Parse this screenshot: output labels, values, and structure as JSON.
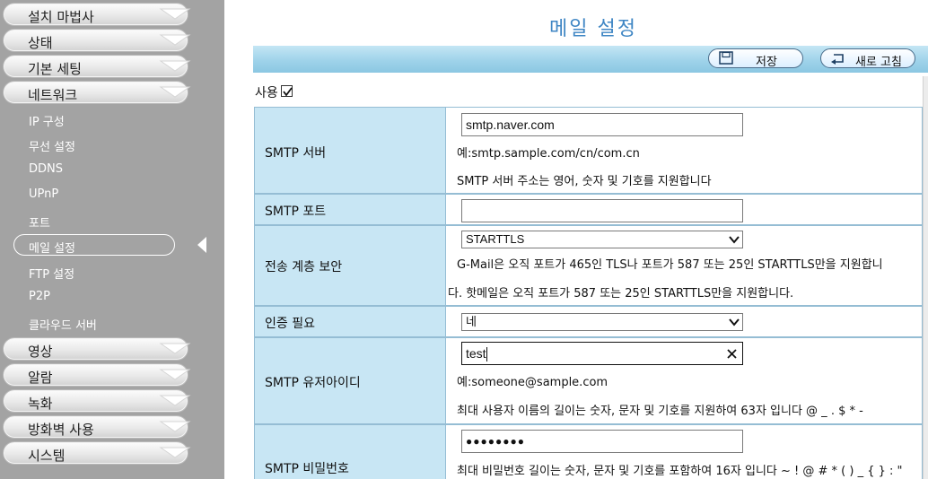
{
  "sidebar": {
    "menus_top": [
      {
        "label": "설치 마법사"
      },
      {
        "label": "상태"
      },
      {
        "label": "기본 세팅"
      },
      {
        "label": "네트워크"
      }
    ],
    "network_items": [
      {
        "label": "IP 구성"
      },
      {
        "label": "무선 설정"
      },
      {
        "label": "DDNS"
      },
      {
        "label": "UPnP"
      },
      {
        "label": "포트"
      },
      {
        "label": "메일 설정"
      },
      {
        "label": "FTP 설정"
      },
      {
        "label": "P2P"
      },
      {
        "label": "클라우드 서버"
      }
    ],
    "menus_bottom": [
      {
        "label": "영상"
      },
      {
        "label": "알람"
      },
      {
        "label": "녹화"
      },
      {
        "label": "방화벽 사용"
      },
      {
        "label": "시스템"
      }
    ]
  },
  "main": {
    "title": "메일 설정",
    "toolbar": {
      "save_label": "저장",
      "refresh_label": "새로 고침"
    },
    "enable": {
      "label": "사용",
      "checked": true
    },
    "form": {
      "smtp_server": {
        "label": "SMTP 서버",
        "value": "smtp.naver.com",
        "example": "예:smtp.sample.com/cn/com.cn",
        "hint": "SMTP 서버 주소는 영어, 숫자 및 기호를 지원합니다"
      },
      "smtp_port": {
        "label": "SMTP 포트",
        "value": ""
      },
      "tls": {
        "label": "전송 계층 보안",
        "selected": "STARTTLS",
        "hint_line1": "G-Mail은 오직 포트가 465인 TLS나 포트가 587 또는 25인 STARTTLS만을 지원합니",
        "hint_line2": "다. 핫메일은 오직 포트가 587 또는 25인 STARTTLS만을 지원합니다."
      },
      "auth": {
        "label": "인증 필요",
        "selected": "네"
      },
      "smtp_user": {
        "label": "SMTP 유저아이디",
        "value": "test",
        "example": "예:someone@sample.com",
        "hint": "최대 사용자 이름의 길이는 숫자, 문자 및 기호를 지원하여 63자 입니다 @ _ . $ * -"
      },
      "smtp_password": {
        "label": "SMTP 비밀번호",
        "value": "●●●●●●●●",
        "hint": "최대 비밀번호 길이는 숫자, 문자 및 기호를 포함하여 16자 입니다 ~ ! @ # * ( ) _ { } : \""
      }
    }
  }
}
